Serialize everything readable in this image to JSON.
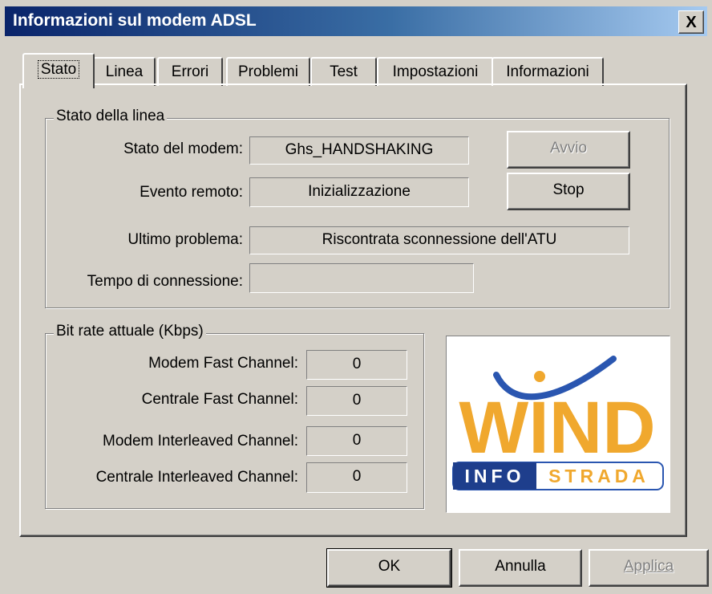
{
  "window": {
    "title": "Informazioni sul modem ADSL",
    "close_glyph": "X"
  },
  "tabs": [
    {
      "label": "Stato",
      "active": true
    },
    {
      "label": "Linea",
      "active": false
    },
    {
      "label": "Errori",
      "active": false
    },
    {
      "label": "Problemi",
      "active": false
    },
    {
      "label": "Test",
      "active": false
    },
    {
      "label": "Impostazioni",
      "active": false
    },
    {
      "label": "Informazioni",
      "active": false
    }
  ],
  "line_status": {
    "group_label": "Stato della linea",
    "modem_state_label": "Stato del modem:",
    "modem_state_value": "Ghs_HANDSHAKING",
    "remote_event_label": "Evento remoto:",
    "remote_event_value": "Inizializzazione",
    "last_problem_label": "Ultimo problema:",
    "last_problem_value": "Riscontrata sconnessione dell'ATU",
    "connection_time_label": "Tempo di connessione:",
    "connection_time_value": "",
    "start_button": "Avvio",
    "stop_button": "Stop"
  },
  "bitrate": {
    "group_label": "Bit rate attuale (Kbps)",
    "rows": [
      {
        "label": "Modem Fast Channel:",
        "value": "0"
      },
      {
        "label": "Centrale Fast Channel:",
        "value": "0"
      },
      {
        "label": "Modem Interleaved Channel:",
        "value": "0"
      },
      {
        "label": "Centrale Interleaved Channel:",
        "value": "0"
      }
    ]
  },
  "logo": {
    "word": "WIND",
    "sub_left": "INFO",
    "sub_right": "STRADA",
    "colors": {
      "orange": "#f0a82e",
      "navy": "#1e3e8c",
      "blue": "#2a56b0",
      "dot": "#f0a82e"
    }
  },
  "footer": {
    "ok_button": "OK",
    "cancel_button": "Annulla",
    "apply_button": "Applica"
  }
}
